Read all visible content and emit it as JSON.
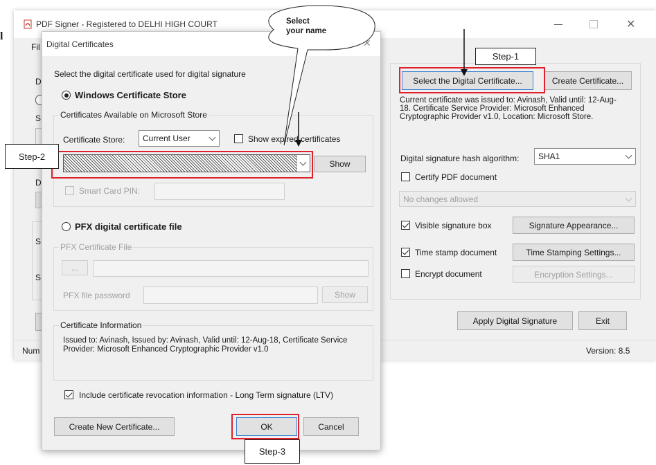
{
  "main_window": {
    "title": "PDF Signer - Registered to DELHI HIGH COURT",
    "menu_first_label": "Fil",
    "hidden_labels": [
      "D",
      "S",
      "D",
      "S",
      "S"
    ],
    "status_left": "Num",
    "version": "Version: 8.5"
  },
  "right_panel": {
    "select_cert_button": "Select the Digital Certificate...",
    "create_cert_button": "Create Certificate...",
    "cert_info": "Current certificate was issued to: Avinash, Valid until: 12-Aug-18. Certificate Service Provider: Microsoft Enhanced Cryptographic Provider v1.0, Location: Microsoft Store.",
    "hash_label": "Digital signature hash algorithm:",
    "hash_value": "SHA1",
    "certify_label": "Certify PDF document",
    "certify_dropdown": "No changes allowed",
    "visible_sig_label": "Visible signature box",
    "sig_appearance_button": "Signature Appearance...",
    "timestamp_label": "Time stamp document",
    "timestamp_settings_button": "Time Stamping Settings...",
    "encrypt_label": "Encrypt document",
    "encryption_settings_button": "Encryption Settings...",
    "apply_button": "Apply Digital Signature",
    "exit_button": "Exit"
  },
  "dialog": {
    "title": "Digital Certificates",
    "intro": "Select the digital certificate used for digital signature",
    "windows_store_radio": "Windows Certificate Store",
    "store_group_legend": "Certificates Available on Microsoft Store",
    "store_label": "Certificate Store:",
    "store_value": "Current User",
    "show_expired_label": "Show expired certificates",
    "show_button": "Show",
    "smart_card_label": "Smart Card PIN:",
    "pfx_radio": "PFX digital certificate file",
    "pfx_group_legend": "PFX Certificate File",
    "pfx_browse": "...",
    "pfx_password_label": "PFX file password",
    "pfx_show_button": "Show",
    "cert_info_legend": "Certificate Information",
    "cert_info_text": "Issued to: Avinash, Issued by: Avinash, Valid until: 12-Aug-18, Certificate Service Provider: Microsoft Enhanced Cryptographic Provider v1.0",
    "ltv_label": "Include certificate revocation information - Long Term signature (LTV)",
    "create_new_button": "Create New Certificate...",
    "ok_button": "OK",
    "cancel_button": "Cancel"
  },
  "annotations": {
    "callout": "Select your name",
    "step1": "Step-1",
    "step2": "Step-2",
    "step3": "Step-3",
    "left_char": "l",
    "highlight_color": "#e0202a"
  },
  "icons": [
    "pdf-app-icon",
    "minimize-icon",
    "maximize-icon",
    "close-icon",
    "dropdown-arrow-icon",
    "checkmark-icon",
    "radio-icon",
    "arrow-down-icon"
  ]
}
